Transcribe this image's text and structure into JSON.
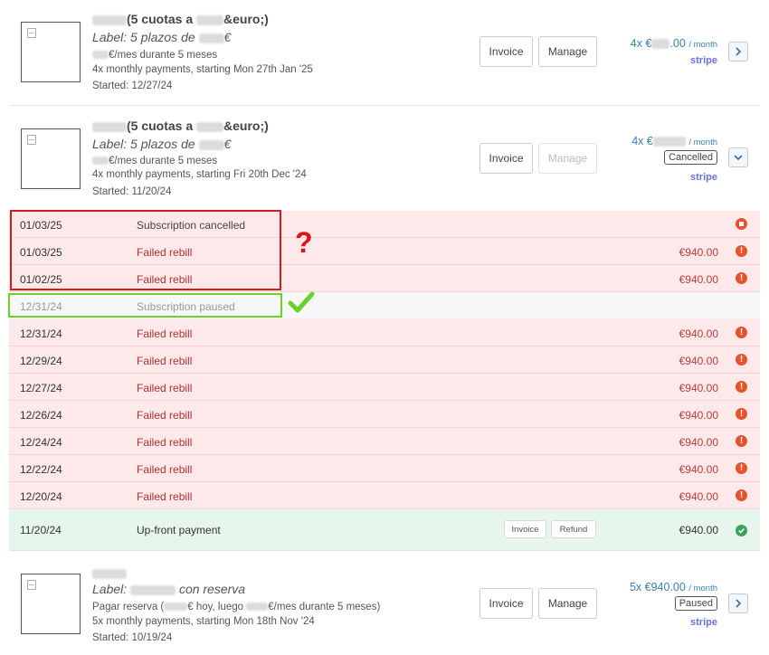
{
  "subscriptions": [
    {
      "title": "(5 cuotas a ",
      "title_suffix": "&euro;)",
      "label_prefix": "Label: 5 plazos de ",
      "label_suffix": "€",
      "desc1": "€/mes durante 5 meses",
      "desc2": "4x monthly payments, starting Mon 27th Jan '25",
      "started": "Started: 12/27/24",
      "invoice_label": "Invoice",
      "manage_label": "Manage",
      "amount_prefix": "4x €",
      "amount_suffix": ".00",
      "per": "/ month",
      "provider": "stripe"
    },
    {
      "title": "(5 cuotas a ",
      "title_suffix": "&euro;)",
      "label_prefix": "Label: 5 plazos de ",
      "label_suffix": "€",
      "desc1": "€/mes durante 5 meses",
      "desc2": "4x monthly payments, starting Fri 20th Dec '24",
      "started": "Started: 11/20/24",
      "invoice_label": "Invoice",
      "manage_label": "Manage",
      "amount_prefix": "4x €",
      "per": "/ month",
      "status": "Cancelled",
      "provider": "stripe"
    },
    {
      "label_prefix": "Label: ",
      "label_suffix": "con reserva",
      "desc1_a": "Pagar reserva (",
      "desc1_b": "€ hoy, luego ",
      "desc1_c": "€/mes durante 5 meses)",
      "desc2": "5x monthly payments, starting Mon 18th Nov '24",
      "started": "Started: 10/19/24",
      "invoice_label": "Invoice",
      "manage_label": "Manage",
      "amount": "5x €940.00",
      "per": "/ month",
      "status": "Paused",
      "provider": "stripe"
    }
  ],
  "events": [
    {
      "date": "01/03/25",
      "desc": "Subscription cancelled",
      "amount": "",
      "kind": "cancel"
    },
    {
      "date": "01/03/25",
      "desc": "Failed rebill",
      "amount": "€940.00",
      "kind": "failed"
    },
    {
      "date": "01/02/25",
      "desc": "Failed rebill",
      "amount": "€940.00",
      "kind": "failed"
    },
    {
      "date": "12/31/24",
      "desc": "Subscription paused",
      "amount": "",
      "kind": "paused"
    },
    {
      "date": "12/31/24",
      "desc": "Failed rebill",
      "amount": "€940.00",
      "kind": "failed"
    },
    {
      "date": "12/29/24",
      "desc": "Failed rebill",
      "amount": "€940.00",
      "kind": "failed"
    },
    {
      "date": "12/27/24",
      "desc": "Failed rebill",
      "amount": "€940.00",
      "kind": "failed"
    },
    {
      "date": "12/26/24",
      "desc": "Failed rebill",
      "amount": "€940.00",
      "kind": "failed"
    },
    {
      "date": "12/24/24",
      "desc": "Failed rebill",
      "amount": "€940.00",
      "kind": "failed"
    },
    {
      "date": "12/22/24",
      "desc": "Failed rebill",
      "amount": "€940.00",
      "kind": "failed"
    },
    {
      "date": "12/20/24",
      "desc": "Failed rebill",
      "amount": "€940.00",
      "kind": "failed"
    }
  ],
  "upfront": {
    "date": "11/20/24",
    "desc": "Up-front payment",
    "invoice_label": "Invoice",
    "refund_label": "Refund",
    "amount": "€940.00"
  },
  "annotation": {
    "question_mark": "?"
  },
  "colors": {
    "failed_row_bg": "#fde9e9",
    "success_row_bg": "#e7f6ec",
    "error_icon": "#e5532d",
    "success_icon": "#3aa55a",
    "accent_blue": "#3c7fb1",
    "stripe": "#6772e5",
    "annotation_red": "#d51b1b",
    "annotation_green": "#68d12a"
  }
}
